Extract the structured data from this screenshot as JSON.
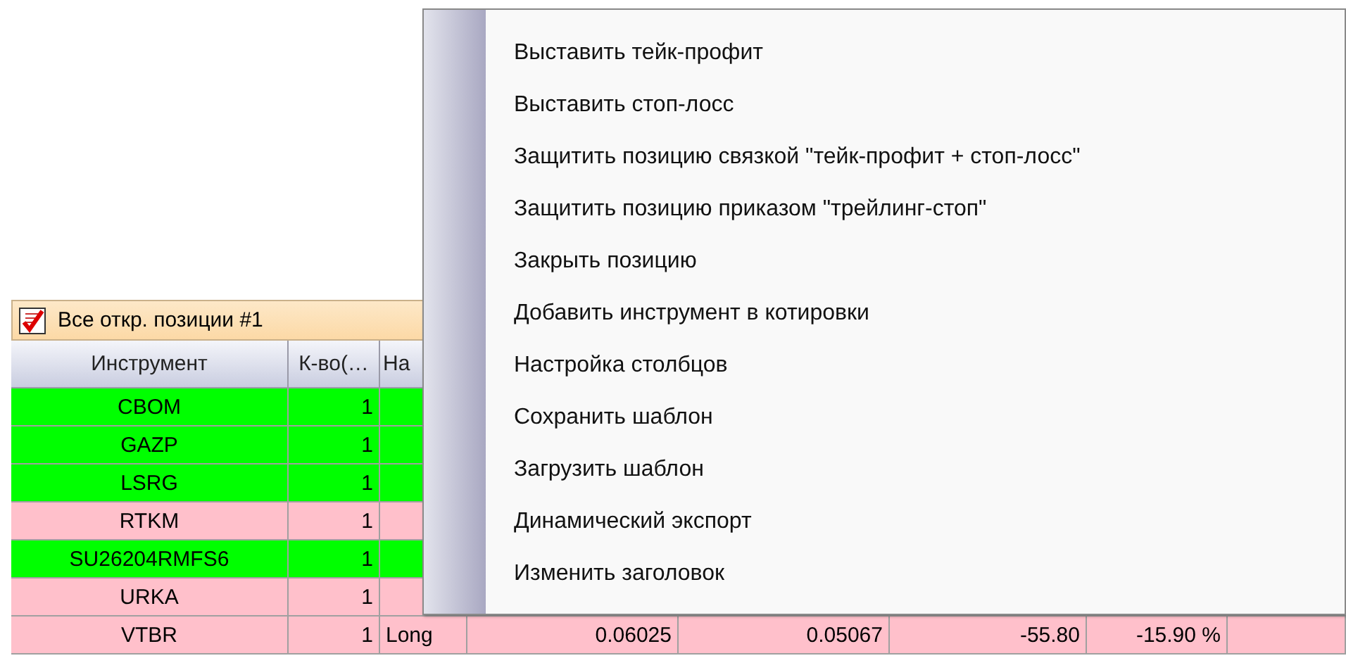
{
  "positions_window": {
    "title": "Все откр. позиции #1",
    "columns": [
      "Инструмент",
      "К-во(…",
      "На"
    ],
    "rows": [
      {
        "cells": [
          "CBOM",
          "1"
        ],
        "color": "#00ff00"
      },
      {
        "cells": [
          "GAZP",
          "1"
        ],
        "color": "#00ff00"
      },
      {
        "cells": [
          "LSRG",
          "1"
        ],
        "color": "#00ff00"
      },
      {
        "cells": [
          "RTKM",
          "1"
        ],
        "color": "#ffc0cb"
      },
      {
        "cells": [
          "SU26204RMFS6",
          "1"
        ],
        "color": "#00ff00"
      },
      {
        "cells": [
          "URKA",
          "1"
        ],
        "color": "#ffc0cb"
      },
      {
        "cells": [
          "VTBR",
          "1",
          "Long",
          "0.06025",
          "0.05067",
          "-55.80",
          "-15.90 %"
        ],
        "color": "#ffc0cb"
      }
    ]
  },
  "context_menu": {
    "items": [
      "Выставить тейк-профит",
      "Выставить стоп-лосс",
      "Защитить позицию связкой \"тейк-профит + стоп-лосс\"",
      "Защитить позицию приказом \"трейлинг-стоп\"",
      "Закрыть позицию",
      "Добавить инструмент в котировки",
      "Настройка столбцов",
      "Сохранить шаблон",
      "Загрузить шаблон",
      "Динамический экспорт",
      "Изменить заголовок"
    ]
  }
}
